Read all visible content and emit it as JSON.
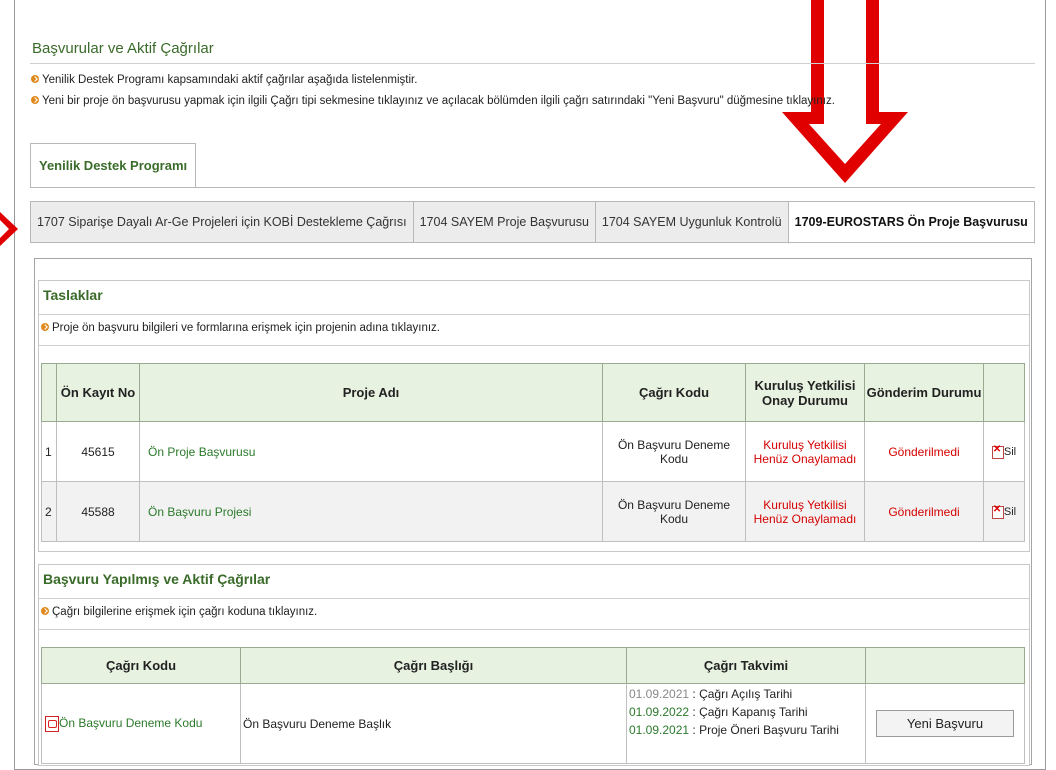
{
  "header": {
    "title": "Başvurular ve Aktif Çağrılar",
    "info1": "Yenilik Destek Programı kapsamındaki aktif çağrılar aşağıda listelenmiştir.",
    "info2": "Yeni bir proje ön başvurusu yapmak için ilgili Çağrı tipi sekmesine tıklayınız ve açılacak bölümden ilgili çağrı satırındaki \"Yeni Başvuru\" düğmesine tıklayınız."
  },
  "main_tab": "Yenilik Destek Programı",
  "subtabs": [
    "1707 Siparişe Dayalı Ar-Ge Projeleri için KOBİ Destekleme Çağrısı",
    "1704 SAYEM Proje Başvurusu",
    "1704 SAYEM Uygunluk Kontrolü",
    "1709-EUROSTARS Ön Proje Başvurusu"
  ],
  "drafts": {
    "title": "Taslaklar",
    "info": "Proje ön başvuru bilgileri ve formlarına erişmek için projenin adına tıklayınız.",
    "headers": [
      "",
      "Ön Kayıt No",
      "Proje Adı",
      "Çağrı Kodu",
      "Kuruluş Yetkilisi Onay Durumu",
      "Gönderim Durumu",
      ""
    ],
    "rows": [
      {
        "idx": "1",
        "kayit": "45615",
        "ad": "Ön Proje Başvurusu",
        "kod": "Ön Başvuru Deneme Kodu",
        "onay": "Kuruluş Yetkilisi Henüz Onaylamadı",
        "gonderim": "Gönderilmedi",
        "sil": "Sil"
      },
      {
        "idx": "2",
        "kayit": "45588",
        "ad": "Ön Başvuru Projesi",
        "kod": "Ön Başvuru Deneme Kodu",
        "onay": "Kuruluş Yetkilisi Henüz Onaylamadı",
        "gonderim": "Gönderilmedi",
        "sil": "Sil"
      }
    ]
  },
  "calls": {
    "title": "Başvuru Yapılmış ve Aktif Çağrılar",
    "info": "Çağrı bilgilerine erişmek için çağrı koduna tıklayınız.",
    "headers": [
      "Çağrı Kodu",
      "Çağrı Başlığı",
      "Çağrı Takvimi",
      ""
    ],
    "row": {
      "kod": "Ön Başvuru Deneme Kodu",
      "baslik": "Ön Başvuru Deneme Başlık",
      "takvim": [
        {
          "date": "01.09.2021",
          "label": " : Çağrı Açılış Tarihi",
          "color": "gray"
        },
        {
          "date": "01.09.2022",
          "label": " : Çağrı Kapanış Tarihi",
          "color": "green"
        },
        {
          "date": "01.09.2021",
          "label": " : Proje Öneri Başvuru Tarihi",
          "color": "green"
        }
      ],
      "button": "Yeni Başvuru"
    }
  },
  "colors": {
    "title_green": "#3a6b2a",
    "arrow_red": "#e00000",
    "status_red": "#d50000",
    "header_bg": "#e7f2e1"
  }
}
